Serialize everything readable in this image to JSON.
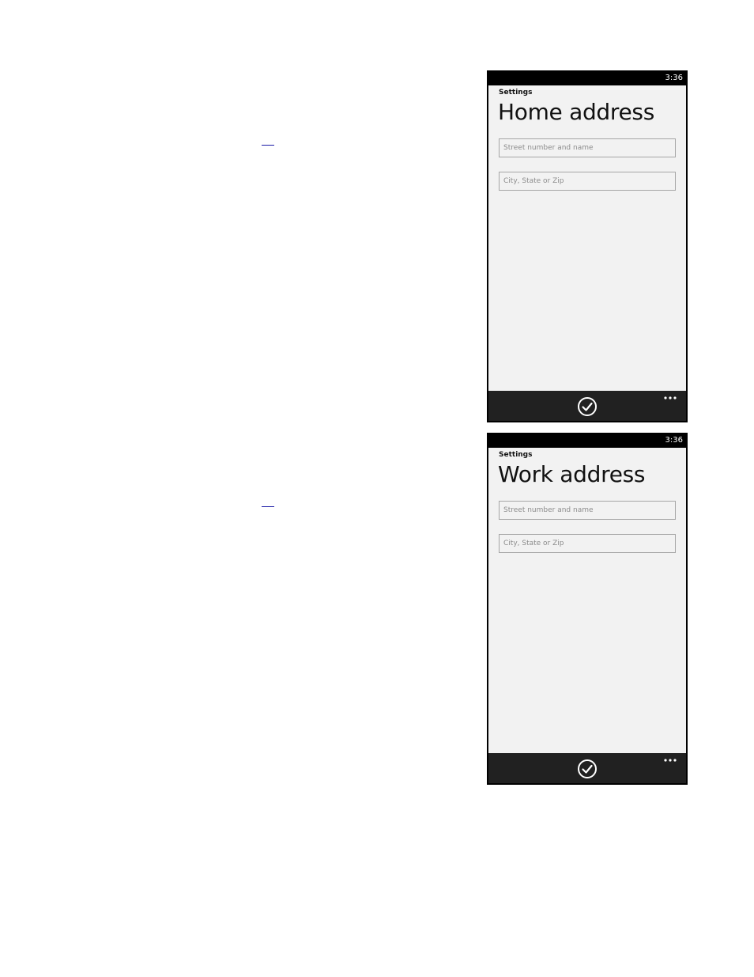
{
  "screens": [
    {
      "status_time": "3:36",
      "app_label": "Settings",
      "title": "Home address",
      "street_field": {
        "placeholder": "Street number and name",
        "value": ""
      },
      "city_field": {
        "placeholder": "City, State or Zip",
        "value": ""
      },
      "app_bar": {
        "primary_icon": "check-circle-icon",
        "more_icon": "ellipsis-icon"
      }
    },
    {
      "status_time": "3:36",
      "app_label": "Settings",
      "title": "Work address",
      "street_field": {
        "placeholder": "Street number and name",
        "value": ""
      },
      "city_field": {
        "placeholder": "City, State or Zip",
        "value": ""
      },
      "app_bar": {
        "primary_icon": "check-circle-icon",
        "more_icon": "ellipsis-icon"
      }
    }
  ],
  "colors": {
    "page_background": "#ffffff",
    "screen_background": "#f2f2f2",
    "status_bar": "#000000",
    "app_bar": "#212121",
    "input_border": "#a6a6a6",
    "link": "#1a1aa6"
  }
}
